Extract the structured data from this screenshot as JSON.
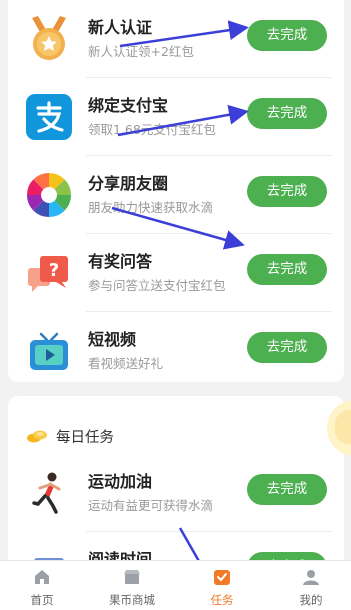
{
  "tasks": [
    {
      "title": "新人认证",
      "subtitle": "新人认证领+2红包",
      "button": "去完成",
      "icon": "medal-star-icon"
    },
    {
      "title": "绑定支付宝",
      "subtitle": "领取1.68元支付宝红包",
      "button": "去完成",
      "icon": "alipay-icon"
    },
    {
      "title": "分享朋友圈",
      "subtitle": "朋友助力快速获取水滴",
      "button": "去完成",
      "icon": "camera-aperture-icon"
    },
    {
      "title": "有奖问答",
      "subtitle": "参与问答立送支付宝红包",
      "button": "去完成",
      "icon": "question-chat-icon"
    },
    {
      "title": "短视频",
      "subtitle": "看视频送好礼",
      "button": "去完成",
      "icon": "tv-play-icon"
    }
  ],
  "daily": {
    "title": "每日任务",
    "icon": "coins-icon",
    "tasks": [
      {
        "title": "运动加油",
        "subtitle": "运动有益更可获得水滴",
        "button": "去完成",
        "icon": "runner-icon"
      },
      {
        "title": "阅读时间",
        "subtitle": "",
        "button": "去完成",
        "icon": "book-icon"
      }
    ]
  },
  "tabbar": {
    "items": [
      {
        "label": "首页",
        "icon": "home-icon"
      },
      {
        "label": "果币商城",
        "icon": "shop-icon"
      },
      {
        "label": "任务",
        "icon": "task-icon"
      },
      {
        "label": "我的",
        "icon": "user-icon"
      }
    ],
    "active_index": 2
  },
  "colors": {
    "accent": "#4caf50",
    "active_tab": "#f07a28",
    "annotation_arrow": "#3b3fd8"
  }
}
